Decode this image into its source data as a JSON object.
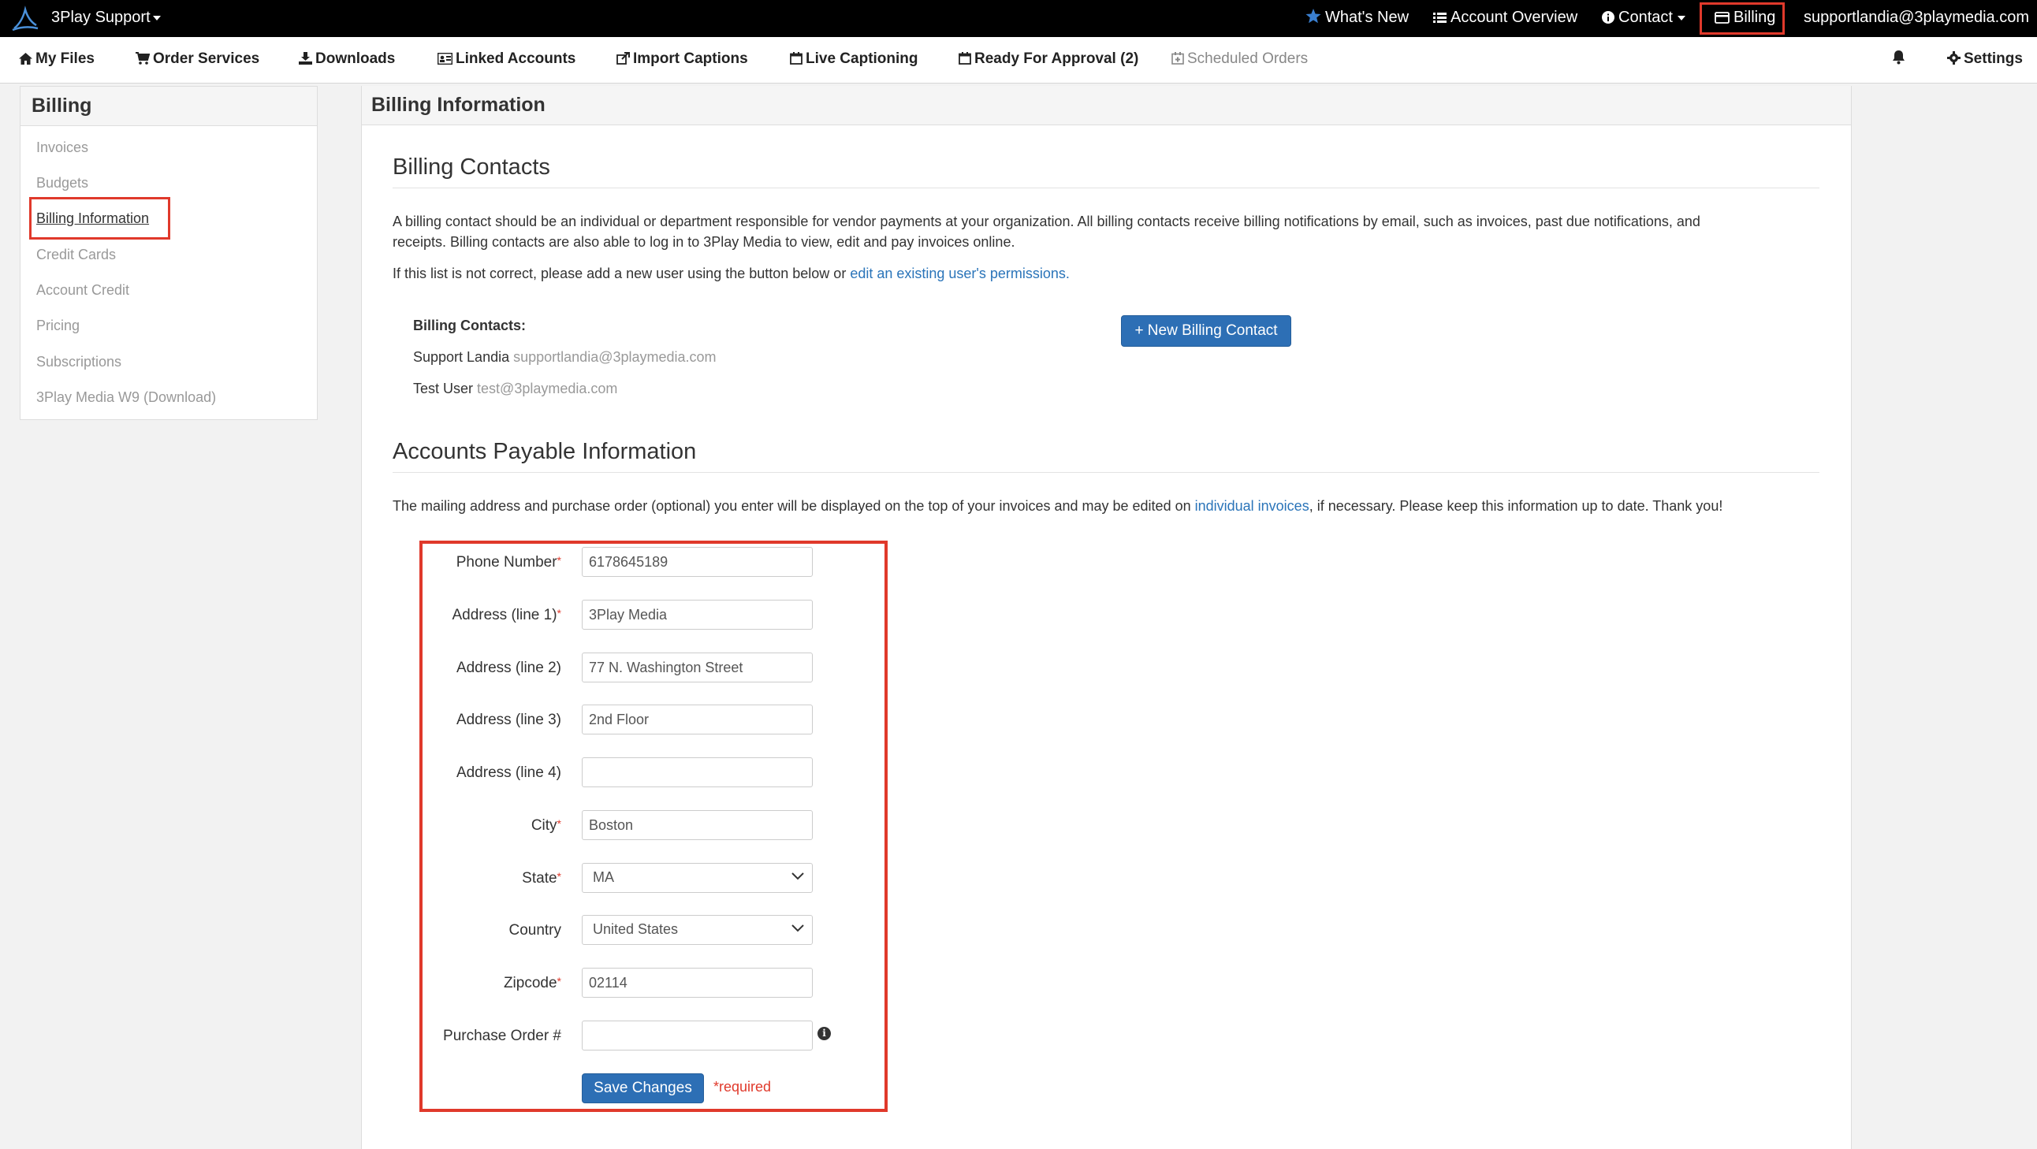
{
  "topbar": {
    "brand": "3Play Support",
    "whats_new": "What's New",
    "account_overview": "Account Overview",
    "contact": "Contact",
    "billing": "Billing",
    "user_email": "supportlandia@3playmedia.com"
  },
  "nav": {
    "my_files": "My Files",
    "order_services": "Order Services",
    "downloads": "Downloads",
    "linked_accounts": "Linked Accounts",
    "import_captions": "Import Captions",
    "live_captioning": "Live Captioning",
    "ready_for_approval": "Ready For Approval (2)",
    "scheduled_orders": "Scheduled Orders",
    "settings": "Settings"
  },
  "sidebar": {
    "title": "Billing",
    "items": [
      {
        "label": "Invoices"
      },
      {
        "label": "Budgets"
      },
      {
        "label": "Billing Information"
      },
      {
        "label": "Credit Cards"
      },
      {
        "label": "Account Credit"
      },
      {
        "label": "Pricing"
      },
      {
        "label": "Subscriptions"
      },
      {
        "label": "3Play Media W9 (Download)"
      }
    ],
    "active_index": 2
  },
  "main": {
    "panel_title": "Billing Information",
    "contacts_section": {
      "title": "Billing Contacts",
      "desc_line1": "A billing contact should be an individual or department responsible for vendor payments at your organization. All billing contacts receive billing notifications by email, such as invoices, past due notifications, and",
      "desc_line2": "receipts. Billing contacts are also able to log in to 3Play Media to view, edit and pay invoices online.",
      "note_prefix": "If this list is not correct, please add a new user using the button below or ",
      "note_link": "edit an existing user's permissions.",
      "list_label": "Billing Contacts:",
      "contacts": [
        {
          "name": "Support Landia",
          "email": "supportlandia@3playmedia.com"
        },
        {
          "name": "Test User",
          "email": "test@3playmedia.com"
        }
      ],
      "new_contact_button": "+ New Billing Contact"
    },
    "ap_section": {
      "title": "Accounts Payable Information",
      "desc_prefix": "The mailing address and purchase order (optional) you enter will be displayed on the top of your invoices and may be edited on ",
      "desc_link": "individual invoices",
      "desc_suffix": ", if necessary. Please keep this information up to date. Thank you!"
    },
    "form": {
      "phone": {
        "label": "Phone Number",
        "value": "6178645189",
        "required": "*"
      },
      "addr1": {
        "label": "Address (line 1)",
        "value": "3Play Media",
        "required": "*"
      },
      "addr2": {
        "label": "Address (line 2)",
        "value": "77 N. Washington Street"
      },
      "addr3": {
        "label": "Address (line 3)",
        "value": "2nd Floor"
      },
      "addr4": {
        "label": "Address (line 4)",
        "value": ""
      },
      "city": {
        "label": "City",
        "value": "Boston",
        "required": "*"
      },
      "state": {
        "label": "State",
        "value": "MA",
        "required": "*"
      },
      "country": {
        "label": "Country",
        "value": "United States"
      },
      "zipcode": {
        "label": "Zipcode",
        "value": "02114",
        "required": "*"
      },
      "po": {
        "label": "Purchase Order #",
        "value": ""
      },
      "save_button": "Save Changes",
      "required_note": "*required"
    }
  },
  "colors": {
    "topbar_bg": "#000000",
    "accent_blue": "#2d6fb5",
    "highlight_red": "#e0392b"
  }
}
